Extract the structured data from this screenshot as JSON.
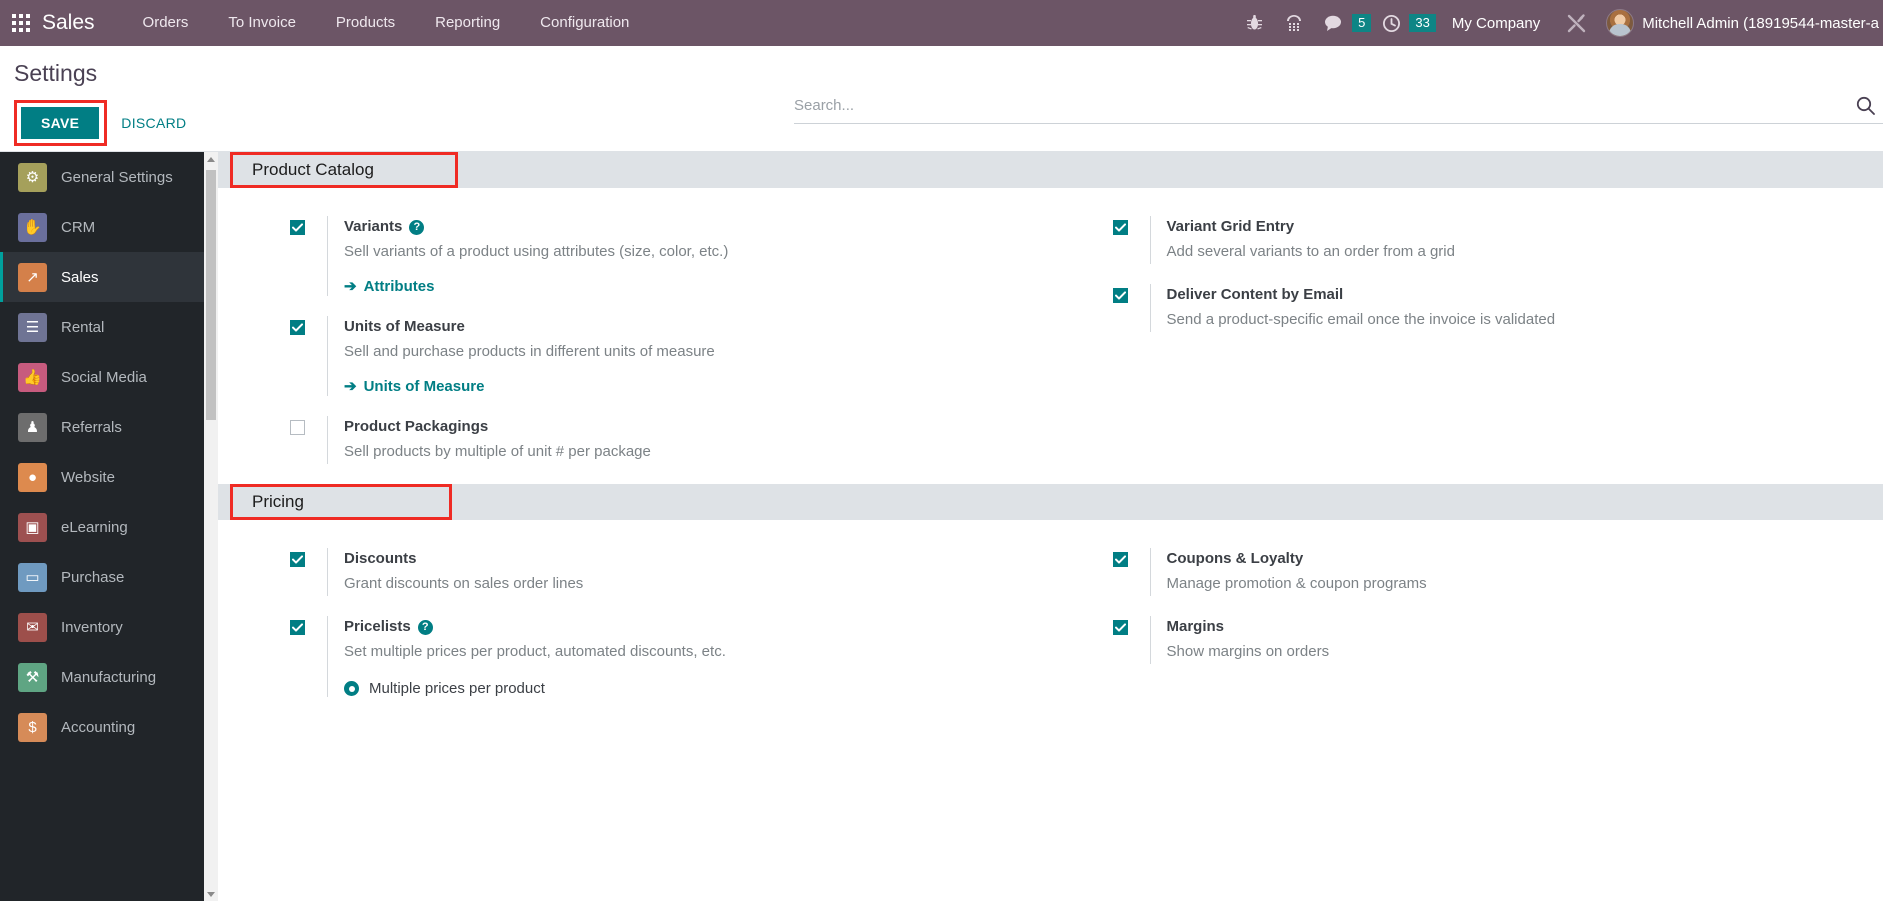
{
  "navbar": {
    "apps_icon": "apps-grid-icon",
    "brand": "Sales",
    "menu": [
      {
        "label": "Orders"
      },
      {
        "label": "To Invoice"
      },
      {
        "label": "Products"
      },
      {
        "label": "Reporting"
      },
      {
        "label": "Configuration"
      }
    ],
    "icons": [
      {
        "name": "bug-icon",
        "glyph": "☣"
      },
      {
        "name": "dialpad-icon",
        "glyph": "⌸"
      }
    ],
    "messages": {
      "icon": "chat-bubble-icon",
      "count": "5"
    },
    "activities": {
      "icon": "clock-icon",
      "count": "33"
    },
    "company": "My Company",
    "tools_icon": "wrench-screwdriver-icon",
    "avatar": "user-avatar",
    "user": "Mitchell Admin (18919544-master-a"
  },
  "control_panel": {
    "title": "Settings",
    "save_label": "SAVE",
    "discard_label": "DISCARD",
    "save_accent": "#017e84",
    "annotation_color": "#ef2b24"
  },
  "search": {
    "placeholder": "Search...",
    "icon": "search-icon"
  },
  "sidebar": {
    "items": [
      {
        "label": "General Settings",
        "icon": "gear-icon",
        "glyph": "⚙",
        "color": "#a5a05b",
        "active": false
      },
      {
        "label": "CRM",
        "icon": "handshake-icon",
        "glyph": "✋",
        "color": "#6a6f9c",
        "active": false
      },
      {
        "label": "Sales",
        "icon": "chart-up-icon",
        "glyph": "↗",
        "color": "#d4804a",
        "active": true
      },
      {
        "label": "Rental",
        "icon": "calendar-list-icon",
        "glyph": "☰",
        "color": "#6f7494",
        "active": false
      },
      {
        "label": "Social Media",
        "icon": "thumbs-up-icon",
        "glyph": "👍",
        "color": "#c75b7e",
        "active": false
      },
      {
        "label": "Referrals",
        "icon": "person-icon",
        "glyph": "♟",
        "color": "#6d6d6d",
        "active": false
      },
      {
        "label": "Website",
        "icon": "globe-icon",
        "glyph": "●",
        "color": "#dd8a4e",
        "active": false
      },
      {
        "label": "eLearning",
        "icon": "presentation-icon",
        "glyph": "▣",
        "color": "#9d5050",
        "active": false
      },
      {
        "label": "Purchase",
        "icon": "credit-card-icon",
        "glyph": "▭",
        "color": "#6f9ac0",
        "active": false
      },
      {
        "label": "Inventory",
        "icon": "box-icon",
        "glyph": "✉",
        "color": "#9d4f4b",
        "active": false
      },
      {
        "label": "Manufacturing",
        "icon": "wrench-icon",
        "glyph": "⚒",
        "color": "#5fa583",
        "active": false
      },
      {
        "label": "Accounting",
        "icon": "invoice-dollar-icon",
        "glyph": "$",
        "color": "#d68b58",
        "active": false
      }
    ]
  },
  "sections": [
    {
      "title": "Product Catalog",
      "annotated": true,
      "left": [
        {
          "label": "Variants",
          "description": "Sell variants of a product using attributes (size, color, etc.)",
          "checked": true,
          "help": true,
          "link": "Attributes"
        },
        {
          "label": "Units of Measure",
          "description": "Sell and purchase products in different units of measure",
          "checked": true,
          "help": false,
          "link": "Units of Measure"
        },
        {
          "label": "Product Packagings",
          "description": "Sell products by multiple of unit # per package",
          "checked": false,
          "help": false,
          "link": null
        }
      ],
      "right": [
        {
          "label": "Variant Grid Entry",
          "description": "Add several variants to an order from a grid",
          "checked": true,
          "help": false,
          "link": null
        },
        {
          "label": "Deliver Content by Email",
          "description": "Send a product-specific email once the invoice is validated",
          "checked": true,
          "help": false,
          "link": null
        }
      ]
    },
    {
      "title": "Pricing",
      "annotated": true,
      "left": [
        {
          "label": "Discounts",
          "description": "Grant discounts on sales order lines",
          "checked": true,
          "help": false,
          "link": null
        },
        {
          "label": "Pricelists",
          "description": "Set multiple prices per product, automated discounts, etc.",
          "checked": true,
          "help": true,
          "link": null,
          "radio_option": "Multiple prices per product",
          "radio_selected": true
        }
      ],
      "right": [
        {
          "label": "Coupons & Loyalty",
          "description": "Manage promotion & coupon programs",
          "checked": true,
          "help": false,
          "link": null
        },
        {
          "label": "Margins",
          "description": "Show margins on orders",
          "checked": true,
          "help": false,
          "link": null
        }
      ]
    }
  ]
}
